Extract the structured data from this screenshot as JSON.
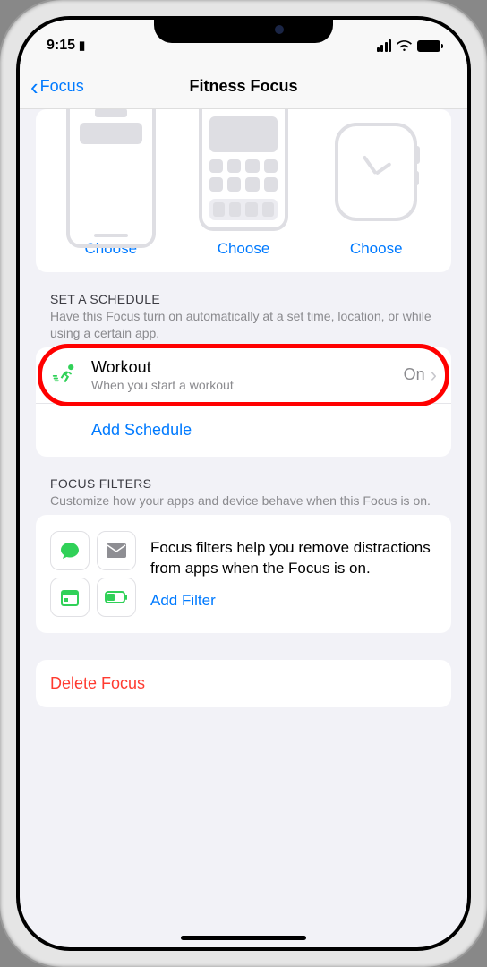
{
  "status": {
    "time": "9:15",
    "carrier_icon": "▮"
  },
  "nav": {
    "back_label": "Focus",
    "title": "Fitness Focus"
  },
  "previews": {
    "lock_screen_label": "Choose",
    "home_screen_label": "Choose",
    "watch_label": "Choose"
  },
  "schedule": {
    "header": "SET A SCHEDULE",
    "desc": "Have this Focus turn on automatically at a set time, location, or while using a certain app.",
    "workout": {
      "title": "Workout",
      "subtitle": "When you start a workout",
      "value": "On"
    },
    "add_label": "Add Schedule"
  },
  "filters": {
    "header": "FOCUS FILTERS",
    "desc": "Customize how your apps and device behave when this Focus is on.",
    "body": "Focus filters help you remove distractions from apps when the Focus is on.",
    "add_label": "Add Filter"
  },
  "delete": {
    "label": "Delete Focus"
  },
  "colors": {
    "accent": "#007aff",
    "danger": "#ff3b30",
    "workout_green": "#30d158"
  }
}
